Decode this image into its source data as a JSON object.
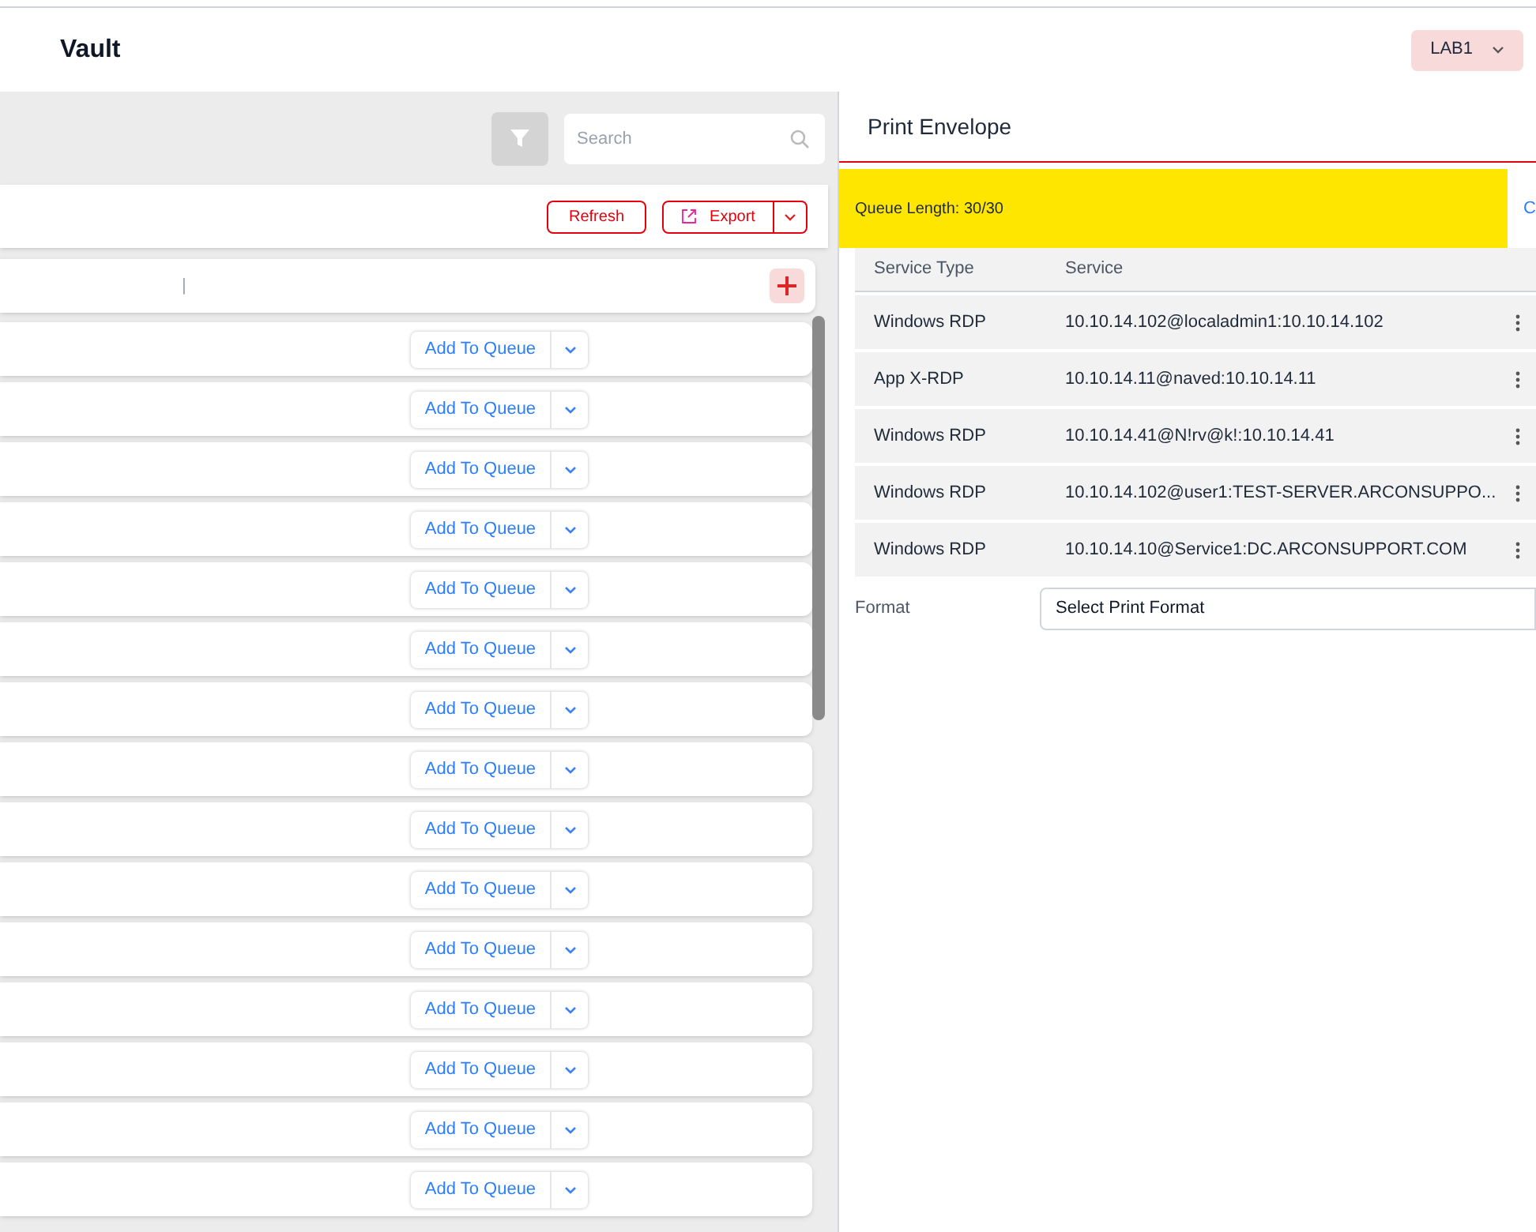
{
  "header": {
    "title": "Vault",
    "lab": "LAB1"
  },
  "toolbar": {
    "search_placeholder": "Search",
    "refresh": "Refresh",
    "export": "Export",
    "column_separator": "|"
  },
  "list_rows": [
    {
      "action": "Add To Queue"
    },
    {
      "action": "Add To Queue"
    },
    {
      "action": "Add To Queue"
    },
    {
      "action": "Add To Queue"
    },
    {
      "action": "Add To Queue"
    },
    {
      "action": "Add To Queue"
    },
    {
      "action": "Add To Queue"
    },
    {
      "action": "Add To Queue"
    },
    {
      "action": "Add To Queue"
    },
    {
      "action": "Add To Queue"
    },
    {
      "action": "Add To Queue"
    },
    {
      "action": "Add To Queue"
    },
    {
      "action": "Add To Queue"
    },
    {
      "action": "Add To Queue"
    },
    {
      "action": "Add To Queue"
    }
  ],
  "panel": {
    "title": "Print Envelope",
    "queue_length": "Queue Length: 30/30",
    "link": "C",
    "columns": [
      "Service Type",
      "Service"
    ],
    "rows": [
      {
        "service_type": "Windows RDP",
        "service": "10.10.14.102@localadmin1:10.10.14.102"
      },
      {
        "service_type": "App X-RDP",
        "service": "10.10.14.11@naved:10.10.14.11"
      },
      {
        "service_type": "Windows RDP",
        "service": "10.10.14.41@N!rv@k!:10.10.14.41"
      },
      {
        "service_type": "Windows RDP",
        "service": "10.10.14.102@user1:TEST-SERVER.ARCONSUPPO..."
      },
      {
        "service_type": "Windows RDP",
        "service": "10.10.14.10@Service1:DC.ARCONSUPPORT.COM"
      }
    ],
    "format_label": "Format",
    "format_value": "Select Print Format"
  }
}
